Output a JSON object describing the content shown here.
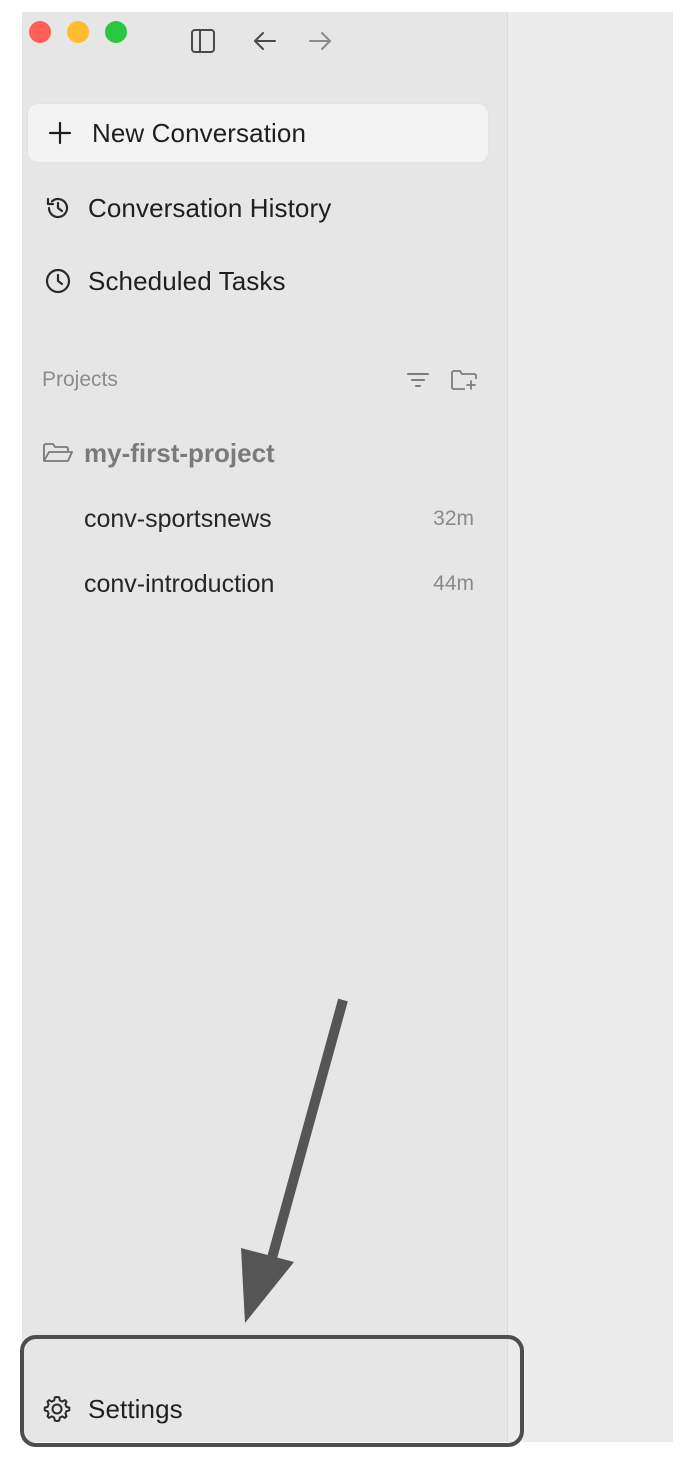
{
  "window_controls": {
    "close_color": "#ff5f57",
    "minimize_color": "#febc2e",
    "zoom_color": "#28c840"
  },
  "toolbar": {
    "icons": [
      "sidebar-toggle-icon",
      "back-arrow-icon",
      "forward-arrow-icon"
    ]
  },
  "sidebar": {
    "new_conversation_label": "New Conversation",
    "conversation_history_label": "Conversation History",
    "scheduled_tasks_label": "Scheduled Tasks",
    "projects": {
      "title": "Projects",
      "items": [
        {
          "name": "my-first-project",
          "conversations": [
            {
              "title": "conv-sportsnews",
              "time": "32m"
            },
            {
              "title": "conv-introduction",
              "time": "44m"
            }
          ]
        }
      ]
    },
    "settings_label": "Settings"
  },
  "annotation": {
    "highlight_color": "#4d4d4d",
    "arrow_color": "#555555"
  }
}
